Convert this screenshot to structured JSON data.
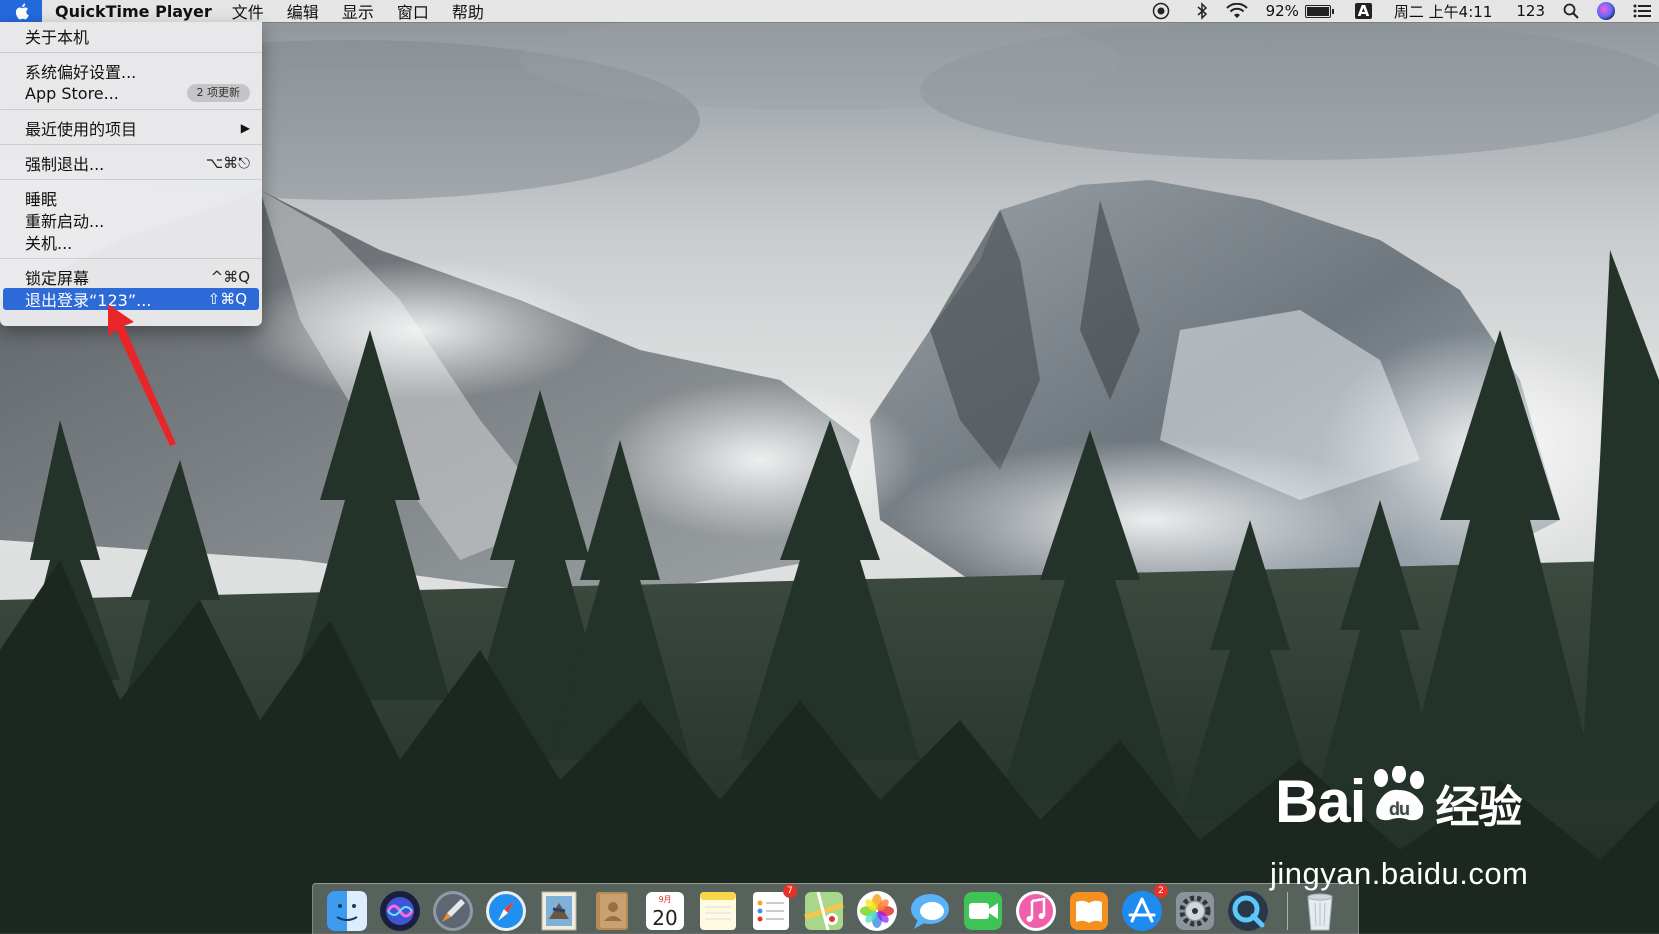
{
  "menubar": {
    "app_name": "QuickTime Player",
    "menus": [
      "文件",
      "编辑",
      "显示",
      "窗口",
      "帮助"
    ],
    "battery_percent": "92%",
    "battery_level": 0.92,
    "input_method": "A",
    "clock": "周二 上午4:11",
    "user": "123",
    "status_icons": [
      "record-icon",
      "bluetooth-icon",
      "wifi-icon",
      "battery-icon",
      "input-method-icon",
      "search-icon",
      "siri-icon",
      "notification-center-icon"
    ]
  },
  "apple_menu": {
    "about": "关于本机",
    "system_prefs": "系统偏好设置...",
    "app_store": "App Store...",
    "app_store_badge": "2 项更新",
    "recent_items": "最近使用的项目",
    "force_quit": "强制退出...",
    "force_quit_shortcut": "⌥⌘⎋",
    "sleep": "睡眠",
    "restart": "重新启动...",
    "shutdown": "关机...",
    "lock_screen": "锁定屏幕",
    "lock_screen_shortcut": "^⌘Q",
    "log_out": "退出登录“123”...",
    "log_out_shortcut": "⇧⌘Q"
  },
  "dock": {
    "apps": [
      "Finder",
      "Siri",
      "Launchpad",
      "Safari",
      "Mail",
      "Contacts",
      "Calendar",
      "Notes",
      "Reminders",
      "Maps",
      "Photos",
      "Messages",
      "FaceTime",
      "iTunes",
      "iBooks",
      "App Store",
      "System Preferences",
      "QuickTime Player",
      "Trash"
    ],
    "calendar_month": "9月",
    "calendar_day": "20",
    "reminders_badge": "7",
    "appstore_badge": "2"
  },
  "watermark": {
    "logo": "Bai",
    "logo_suffix": "经验",
    "url": "jingyan.baidu.com"
  },
  "colors": {
    "selection": "#2d6ad7",
    "annotation": "#e8262a"
  }
}
